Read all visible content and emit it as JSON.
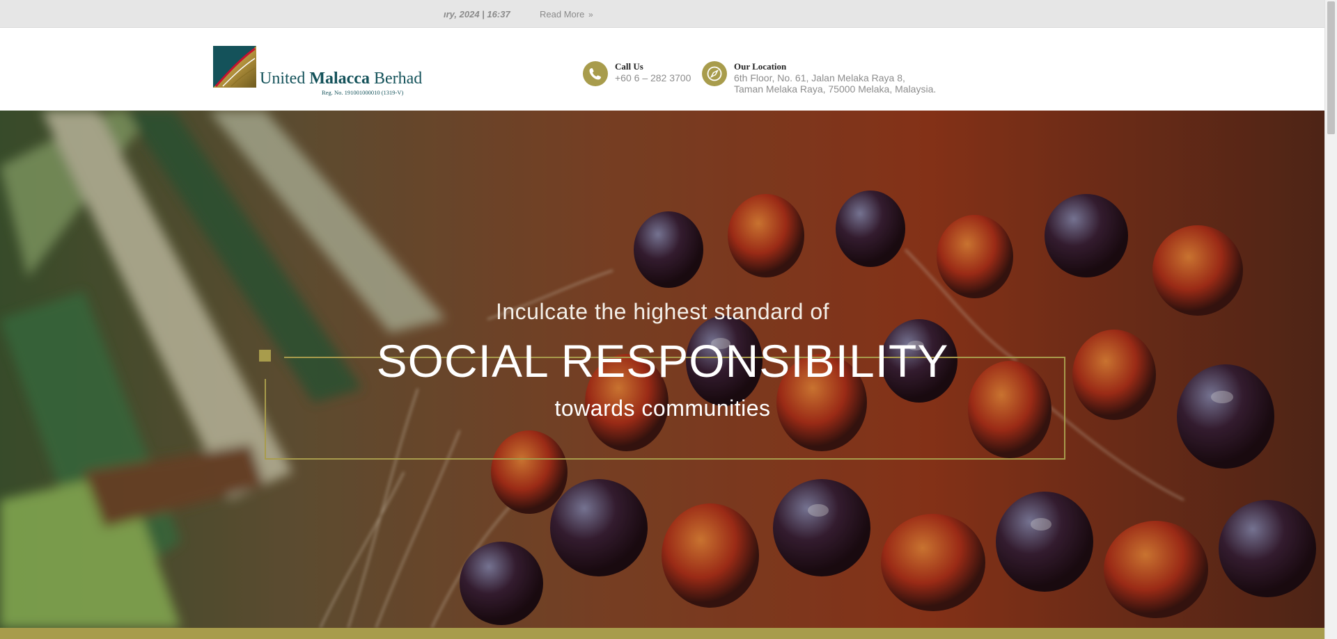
{
  "ticker": {
    "date_text": "ıry, 2024 | 16:37",
    "read_more": "Read More"
  },
  "brand": {
    "name_part1": "United",
    "name_part2": "Malacca",
    "name_part3": "Berhad",
    "reg_no": "Reg. No. 191001000010 (1319-V)"
  },
  "contact": {
    "call_title": "Call Us",
    "call_value": "+60 6 – 282 3700",
    "location_title": "Our Location",
    "location_line1": "6th Floor, No. 61, Jalan Melaka Raya 8,",
    "location_line2": "Taman Melaka Raya, 75000 Melaka, Malaysia."
  },
  "hero": {
    "line1": "Inculcate the highest standard of",
    "line2": "SOCIAL RESPONSIBILITY",
    "line3": "towards communities"
  },
  "colors": {
    "accent": "#a89c4c",
    "brand_teal": "#14525a"
  },
  "icons": [
    "phone-icon",
    "compass-icon",
    "double-chevron-right-icon"
  ]
}
